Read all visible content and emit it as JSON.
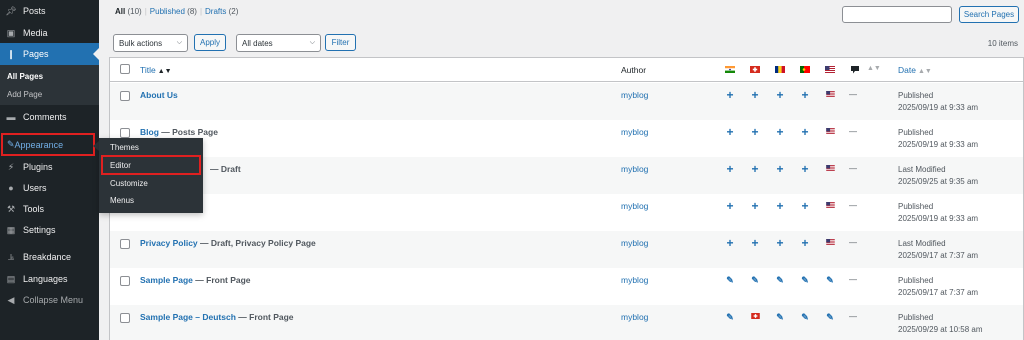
{
  "sidebar": {
    "items": [
      {
        "label": "Posts",
        "icon": "pin-icon"
      },
      {
        "label": "Media",
        "icon": "media-icon"
      },
      {
        "label": "Pages",
        "icon": "pages-icon"
      },
      {
        "label": "Comments",
        "icon": "comment-icon"
      },
      {
        "label": "Appearance",
        "icon": "brush-icon"
      },
      {
        "label": "Plugins",
        "icon": "plugin-icon"
      },
      {
        "label": "Users",
        "icon": "user-icon"
      },
      {
        "label": "Tools",
        "icon": "wrench-icon"
      },
      {
        "label": "Settings",
        "icon": "settings-icon"
      },
      {
        "label": "Breakdance",
        "icon": "breakdance-icon"
      },
      {
        "label": "Languages",
        "icon": "languages-icon"
      },
      {
        "label": "Collapse Menu",
        "icon": "collapse-icon"
      }
    ],
    "pages_submenu": [
      "All Pages",
      "Add Page"
    ]
  },
  "appearance_flyout": {
    "items": [
      "Themes",
      "Editor",
      "Customize",
      "Menus"
    ]
  },
  "filters": {
    "all": "All",
    "all_count": "(10)",
    "published": "Published",
    "published_count": "(8)",
    "drafts": "Drafts",
    "drafts_count": "(2)",
    "separator": "|"
  },
  "toolbar": {
    "search_button": "Search Pages",
    "bulk_actions": "Bulk actions",
    "apply": "Apply",
    "all_dates": "All dates",
    "filter": "Filter",
    "items_count": "10 items"
  },
  "table": {
    "columns": {
      "title": "Title",
      "author": "Author",
      "date": "Date"
    },
    "language_columns": [
      "flag-india",
      "flag-switzerland",
      "flag-romania",
      "flag-portugal",
      "flag-usa",
      "comment-bubble"
    ],
    "rows": [
      {
        "title": "About Us",
        "state": "",
        "author": "myblog",
        "icons": [
          "plus",
          "plus",
          "plus",
          "plus",
          "us"
        ],
        "comments": "—",
        "status": "Published",
        "date": "2025/09/19 at 9:33 am"
      },
      {
        "title": "Blog",
        "state": " — Posts Page",
        "author": "myblog",
        "icons": [
          "plus",
          "plus",
          "plus",
          "plus",
          "us"
        ],
        "comments": "—",
        "status": "Published",
        "date": "2025/09/19 at 9:33 am"
      },
      {
        "title": "",
        "state": "— Draft",
        "author": "myblog",
        "icons": [
          "plus",
          "plus",
          "plus",
          "plus",
          "us"
        ],
        "comments": "—",
        "status": "Last Modified",
        "date": "2025/09/25 at 9:35 am"
      },
      {
        "title": "",
        "state": "",
        "author": "myblog",
        "icons": [
          "plus",
          "plus",
          "plus",
          "plus",
          "us"
        ],
        "comments": "—",
        "status": "Published",
        "date": "2025/09/19 at 9:33 am"
      },
      {
        "title": "Privacy Policy",
        "state": " — Draft, Privacy Policy Page",
        "author": "myblog",
        "icons": [
          "plus",
          "plus",
          "plus",
          "plus",
          "us"
        ],
        "comments": "—",
        "status": "Last Modified",
        "date": "2025/09/17 at 7:37 am"
      },
      {
        "title": "Sample Page",
        "state": " — Front Page",
        "author": "myblog",
        "icons": [
          "pencil",
          "pencil",
          "pencil",
          "pencil",
          "pencil"
        ],
        "comments": "—",
        "status": "Published",
        "date": "2025/09/17 at 7:37 am"
      },
      {
        "title": "Sample Page – Deutsch",
        "state": " — Front Page",
        "author": "myblog",
        "icons": [
          "pencil",
          "swiss",
          "pencil",
          "pencil",
          "pencil"
        ],
        "comments": "—",
        "status": "Published",
        "date": "2025/09/29 at 10:58 am"
      }
    ]
  },
  "colors": {
    "accent": "#2271b1",
    "sidebar_bg": "#1d2327",
    "highlight_red": "#e02020"
  }
}
